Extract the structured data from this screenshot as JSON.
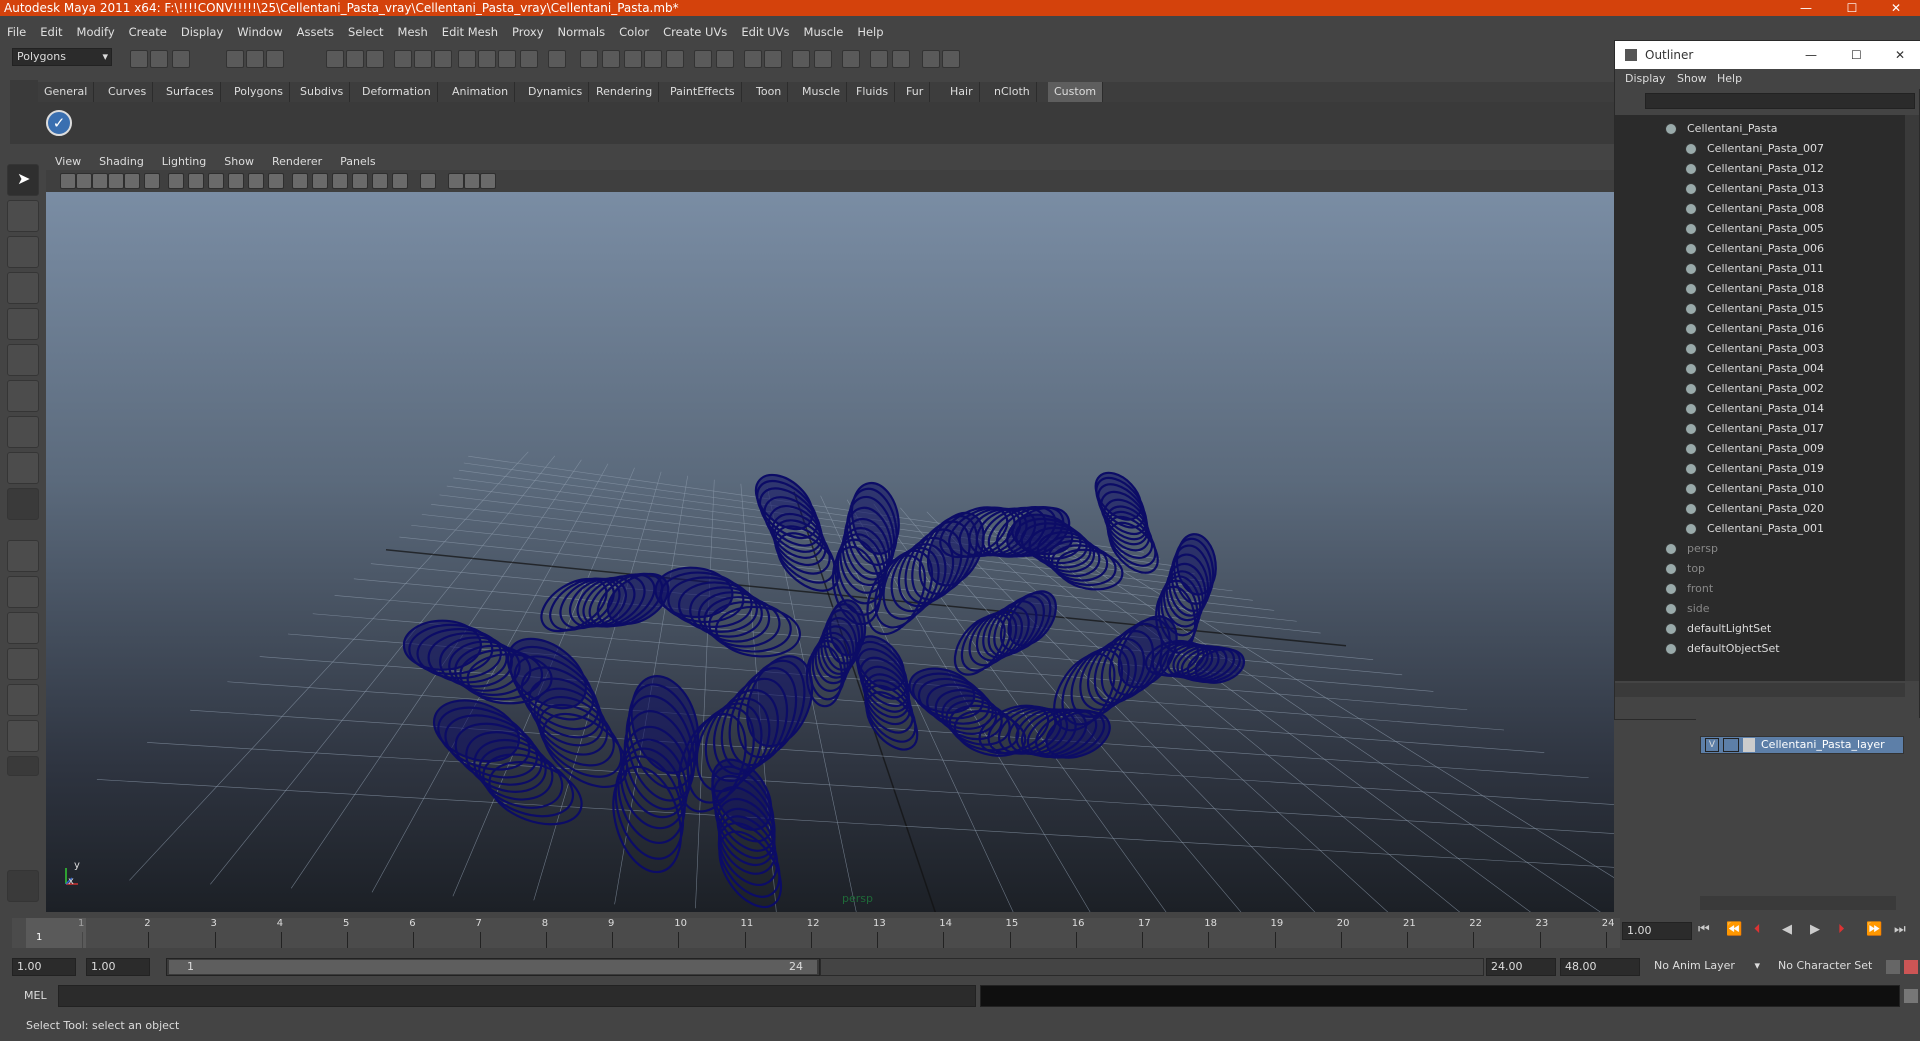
{
  "window": {
    "title": "Autodesk Maya 2011 x64: F:\\!!!!CONV!!!!!\\25\\Cellentani_Pasta_vray\\Cellentani_Pasta_vray\\Cellentani_Pasta.mb*",
    "minimize": "—",
    "maximize": "☐",
    "close": "✕"
  },
  "menubar": [
    "File",
    "Edit",
    "Modify",
    "Create",
    "Display",
    "Window",
    "Assets",
    "Select",
    "Mesh",
    "Edit Mesh",
    "Proxy",
    "Normals",
    "Color",
    "Create UVs",
    "Edit UVs",
    "Muscle",
    "Help"
  ],
  "toolbar": {
    "mode": "Polygons"
  },
  "shelf": {
    "tabs": [
      "General",
      "Curves",
      "Surfaces",
      "Polygons",
      "Subdivs",
      "Deformation",
      "Animation",
      "Dynamics",
      "Rendering",
      "PaintEffects",
      "Toon",
      "Muscle",
      "Fluids",
      "Fur",
      "Hair",
      "nCloth",
      "Custom"
    ],
    "active_tab": "Custom"
  },
  "panel_menu": [
    "View",
    "Shading",
    "Lighting",
    "Show",
    "Renderer",
    "Panels"
  ],
  "viewport": {
    "camera_label": "persp",
    "wire_color": "#0c0c66",
    "axis_y": "y",
    "axis_x": "x"
  },
  "timeline": {
    "ticks": [
      "1",
      "2",
      "3",
      "4",
      "5",
      "6",
      "7",
      "8",
      "9",
      "10",
      "11",
      "12",
      "13",
      "14",
      "15",
      "16",
      "17",
      "18",
      "19",
      "20",
      "21",
      "22",
      "23",
      "24"
    ],
    "current_frame_label": "1",
    "current_time": "1.00"
  },
  "range": {
    "start": "1.00",
    "playback_start": "1.00",
    "range_start_label": "1",
    "range_end_label": "24",
    "playback_end": "24.00",
    "end": "48.00",
    "anim_layer": "No Anim Layer",
    "character_set": "No Character Set"
  },
  "cmdline": {
    "label": "MEL"
  },
  "helpline": {
    "text": "Select Tool: select an object"
  },
  "outliner": {
    "title": "Outliner",
    "menu": [
      "Display",
      "Show",
      "Help"
    ],
    "root": "Cellentani_Pasta",
    "children": [
      "Cellentani_Pasta_007",
      "Cellentani_Pasta_012",
      "Cellentani_Pasta_013",
      "Cellentani_Pasta_008",
      "Cellentani_Pasta_005",
      "Cellentani_Pasta_006",
      "Cellentani_Pasta_011",
      "Cellentani_Pasta_018",
      "Cellentani_Pasta_015",
      "Cellentani_Pasta_016",
      "Cellentani_Pasta_003",
      "Cellentani_Pasta_004",
      "Cellentani_Pasta_002",
      "Cellentani_Pasta_014",
      "Cellentani_Pasta_017",
      "Cellentani_Pasta_009",
      "Cellentani_Pasta_019",
      "Cellentani_Pasta_010",
      "Cellentani_Pasta_020",
      "Cellentani_Pasta_001"
    ],
    "cameras": [
      "persp",
      "top",
      "front",
      "side"
    ],
    "sets": [
      "defaultLightSet",
      "defaultObjectSet"
    ]
  },
  "layers": {
    "visibility": "V",
    "layer_name": "Cellentani_Pasta_layer"
  }
}
